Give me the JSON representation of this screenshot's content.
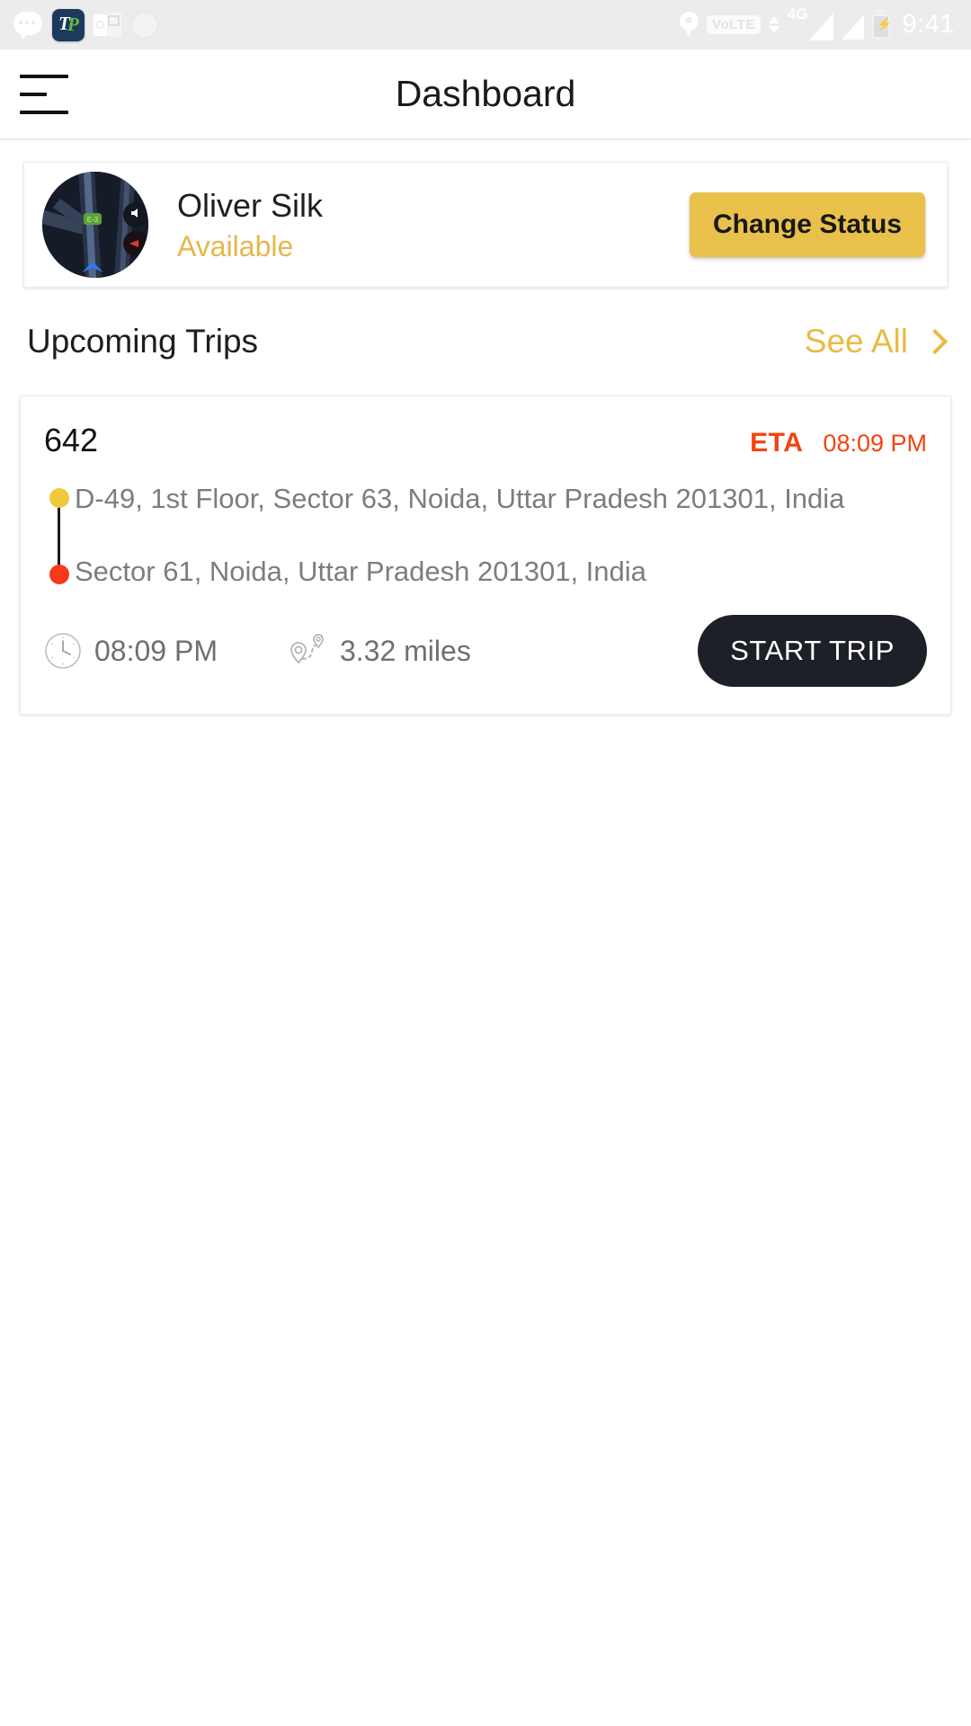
{
  "status_bar": {
    "time": "9:41",
    "volte_label": "VoLTE",
    "network_label": "4G",
    "left_icons": [
      "chat-bubble-icon",
      "tp-app-icon",
      "outlook-icon",
      "circle-icon"
    ],
    "right_icons": [
      "location-pin-icon",
      "volte-icon",
      "data-transfer-icon",
      "signal-4g-icon",
      "signal-bars-icon",
      "battery-charging-icon"
    ],
    "tp_icon_text": {
      "t": "T",
      "p": "P"
    },
    "outlook_icon_text": "O",
    "background": "#ececec",
    "foreground": "#ffffff"
  },
  "app_bar": {
    "title": "Dashboard",
    "menu_icon": "hamburger-menu-icon"
  },
  "profile": {
    "name": "Oliver Silk",
    "status": "Available",
    "status_color": "#e5b84b",
    "avatar_icon": "navigation-map-avatar",
    "change_status_label": "Change Status",
    "change_status_bg": "#e9c14a"
  },
  "upcoming": {
    "section_title": "Upcoming Trips",
    "see_all_label": "See All",
    "see_all_color": "#e8bb45",
    "chevron_icon": "chevron-right-icon"
  },
  "trip": {
    "id": "642",
    "eta_label": "ETA",
    "eta_time": "08:09 PM",
    "eta_color": "#f4430f",
    "pickup_address": "D-49, 1st Floor, Sector 63, Noida, Uttar Pradesh 201301, India",
    "dropoff_address": "Sector 61, Noida, Uttar Pradesh 201301, India",
    "pickup_dot_color": "#f0c83c",
    "dropoff_dot_color": "#f5391a",
    "time_label": "08:09 PM",
    "distance_label": "3.32 miles",
    "time_icon": "clock-icon",
    "distance_icon": "route-distance-icon",
    "start_trip_label": "START TRIP",
    "start_trip_bg": "#1d2026"
  }
}
